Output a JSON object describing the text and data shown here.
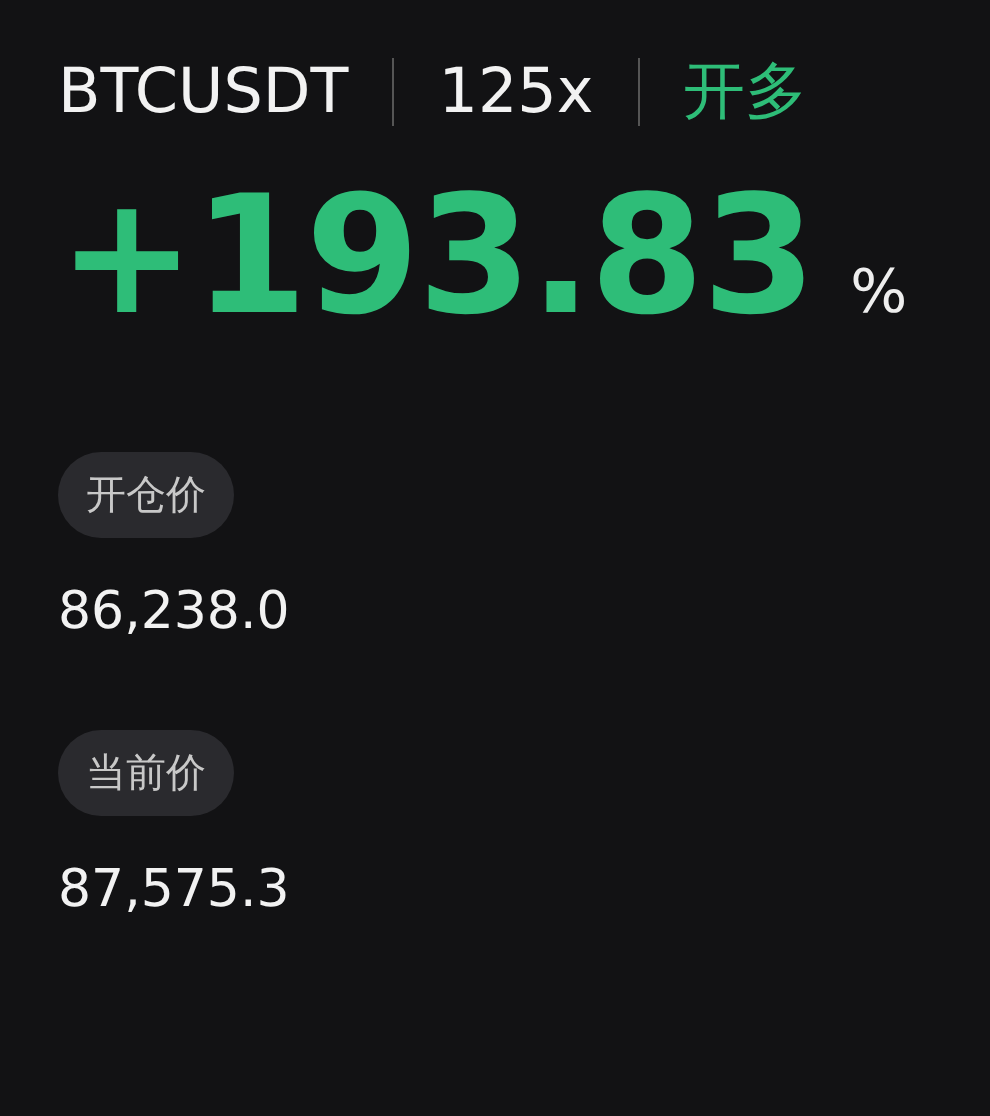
{
  "symbol": "BTCUSDT",
  "leverage": "125x",
  "side": {
    "label": "开多",
    "kind": "long"
  },
  "pnl": {
    "value": "+193.83",
    "unit": "%",
    "kind": "profit"
  },
  "fields": [
    {
      "label": "开仓价",
      "value": "86,238.0"
    },
    {
      "label": "当前价",
      "value": "87,575.3"
    }
  ]
}
